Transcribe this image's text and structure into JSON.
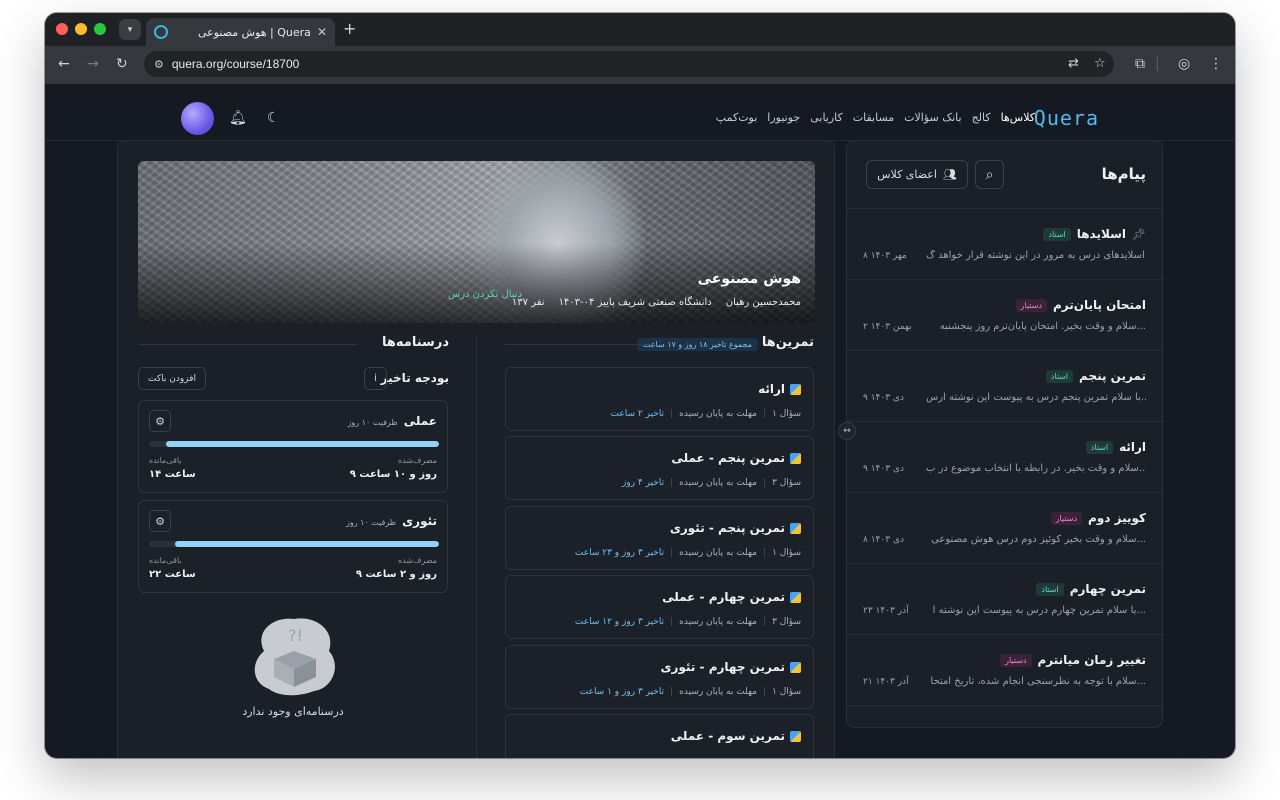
{
  "browser": {
    "tab_title": "هوش مصنوعی | Quera",
    "url": "quera.org/course/18700"
  },
  "header": {
    "logo": "Quera",
    "nav": [
      "کلاس‌ها",
      "کالج",
      "بانک سؤالات",
      "مسابقات",
      "کاریابی",
      "جونیورا",
      "بوت‌کمپ"
    ]
  },
  "messages": {
    "title": "پیام‌ها",
    "members_label": "اعضای کلاس",
    "items": [
      {
        "title": "اسلایدها",
        "badge": "استاد",
        "preview": "اسلایدهای درس به مرور در این نوشته قرار خواهد گ...",
        "date": "۸ مهر ۱۴۰۳"
      },
      {
        "title": "امتحان پایان‌ترم",
        "badge": "دستیار",
        "preview": "سلام و وقت بخیر. امتحان پایان‌ترم روز پنجشنبه...",
        "date": "۲ بهمن ۱۴۰۳"
      },
      {
        "title": "تمرین پنجم",
        "badge": "استاد",
        "preview": "با سلام تمرین پنجم درس به پیوست این نوشته ارس...",
        "date": "۹ دی ۱۴۰۳"
      },
      {
        "title": "ارائه",
        "badge": "استاد",
        "preview": "سلام و وقت بخیر. در رابطه با انتخاب موضوع در ب...",
        "date": "۹ دی ۱۴۰۳"
      },
      {
        "title": "کوییز دوم",
        "badge": "دستیار",
        "preview": "سلام و وقت بخیر کوئیز دوم درس هوش مصنوعی...",
        "date": "۸ دی ۱۴۰۳"
      },
      {
        "title": "تمرین چهارم",
        "badge": "استاد",
        "preview": "با سلام تمرین چهارم درس به پیوست این نوشته ا...",
        "date": "۲۳ آذر ۱۴۰۳"
      },
      {
        "title": "تغییر زمان میانترم",
        "badge": "دستیار",
        "preview": "سلام با توجه به نظرسنجی انجام شده، تاریخ امتحا...",
        "date": "۲۱ آذر ۱۴۰۳"
      }
    ]
  },
  "course": {
    "title": "هوش مصنوعی",
    "instructor": "محمدحسین رهبان",
    "term": "دانشگاه صنعتی شریف پاییز ۰۴-۱۴۰۳",
    "members": "۱۳۷ نفر",
    "follow": "دنبال نکردن درس"
  },
  "exercises": {
    "title": "تمرین‌ها",
    "total_delay": "مجموع تاخیر ۱۸ روز و ۱۷ ساعت",
    "deadline_text": "مهلت به پایان رسیده",
    "items": [
      {
        "title": "ارائه",
        "questions": "۱ سؤال",
        "delay": "تاخیر ۲ ساعت"
      },
      {
        "title": "تمرین پنجم - عملی",
        "questions": "۳ سؤال",
        "delay": "تاخیر ۴ روز"
      },
      {
        "title": "تمرین پنجم - تئوری",
        "questions": "۱ سؤال",
        "delay": "تاخیر ۳ روز و ۲۳ ساعت"
      },
      {
        "title": "تمرین چهارم - عملی",
        "questions": "۳ سؤال",
        "delay": "تاخیر ۳ روز و ۱۲ ساعت"
      },
      {
        "title": "تمرین چهارم - تئوری",
        "questions": "۱ سؤال",
        "delay": "تاخیر ۳ روز و ۱ ساعت"
      },
      {
        "title": "تمرین سوم - عملی",
        "questions": "",
        "delay": ""
      }
    ]
  },
  "syllabus": {
    "title": "درسنامه‌ها",
    "budget_title": "بودجه تاخیر",
    "add_bucket": "افزودن باکت",
    "used_label": "مصرف‌شده",
    "left_label": "باقی‌مانده",
    "buckets": [
      {
        "name": "عملی",
        "capacity": "ظرفیت ۱۰ روز",
        "used": "۹ روز و ۱۰ ساعت",
        "left": "۱۴ ساعت",
        "used_fraction": 0.94
      },
      {
        "name": "تئوری",
        "capacity": "ظرفیت ۱۰ روز",
        "used": "۹ روز و ۲ ساعت",
        "left": "۲۲ ساعت",
        "used_fraction": 0.91
      }
    ],
    "empty_text": "درسنامه‌ای وجود ندارد"
  }
}
